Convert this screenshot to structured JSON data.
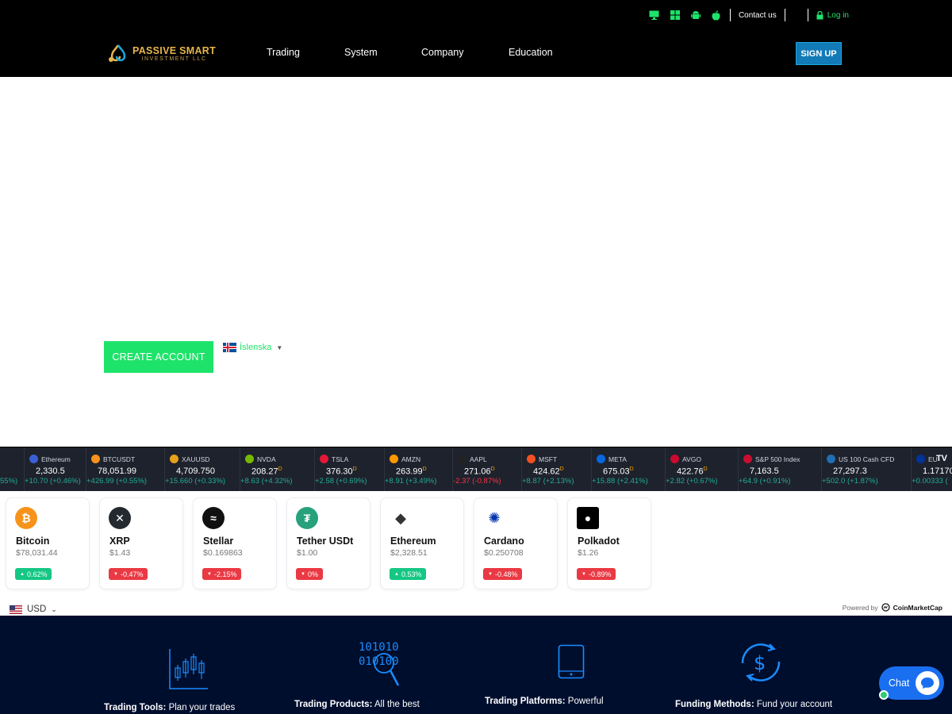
{
  "topbar": {
    "contact": "Contact us",
    "login": "Log in"
  },
  "brand": {
    "name": "PASSIVE SMART",
    "sub": "INVESTMENT LLC"
  },
  "nav": [
    "Trading",
    "System",
    "Company",
    "Education"
  ],
  "signup": "SIGN UP",
  "hero": {
    "create_account": "CREATE ACCOUNT",
    "language": "Íslenska"
  },
  "ticker": [
    {
      "name": "Ethereum",
      "price": "2,330.5",
      "change": "+10.70 (+0.46%)",
      "dir": "up",
      "color": "#3a5fd8",
      "partial_left": "55%)"
    },
    {
      "name": "BTCUSDT",
      "price": "78,051.99",
      "change": "+426.99 (+0.55%)",
      "dir": "up",
      "color": "#f7931a"
    },
    {
      "name": "XAUUSD",
      "price": "4,709.750",
      "change": "+15.660 (+0.33%)",
      "dir": "up",
      "color": "#e8a219"
    },
    {
      "name": "NVDA",
      "price": "208.27",
      "change": "+8.63 (+4.32%)",
      "dir": "up",
      "color": "#76b900"
    },
    {
      "name": "TSLA",
      "price": "376.30",
      "change": "+2.58 (+0.69%)",
      "dir": "up",
      "color": "#e31937"
    },
    {
      "name": "AMZN",
      "price": "263.99",
      "change": "+8.91 (+3.49%)",
      "dir": "up",
      "color": "#ff9900"
    },
    {
      "name": "AAPL",
      "price": "271.06",
      "change": "-2.37 (-0.87%)",
      "dir": "down",
      "color": "#222"
    },
    {
      "name": "MSFT",
      "price": "424.62",
      "change": "+8.87 (+2.13%)",
      "dir": "up",
      "color": "#f25022"
    },
    {
      "name": "META",
      "price": "675.03",
      "change": "+15.88 (+2.41%)",
      "dir": "up",
      "color": "#0668e1"
    },
    {
      "name": "AVGO",
      "price": "422.76",
      "change": "+2.82 (+0.67%)",
      "dir": "up",
      "color": "#cc092f"
    },
    {
      "name": "S&P 500 Index",
      "price": "7,163.5",
      "change": "+64.9 (+0.91%)",
      "dir": "up",
      "color": "#c8102e"
    },
    {
      "name": "US 100 Cash CFD",
      "price": "27,297.3",
      "change": "+502.0 (+1.87%)",
      "dir": "up",
      "color": "#1f6fb2"
    },
    {
      "name": "EU",
      "price": "1.17170",
      "change": "+0.00333 (",
      "dir": "up",
      "color": "#003399"
    }
  ],
  "coins": [
    {
      "name": "Bitcoin",
      "price": "$78,031.44",
      "change": "0.62%",
      "dir": "up",
      "color": "#f7931a",
      "symbol": "₿"
    },
    {
      "name": "XRP",
      "price": "$1.43",
      "change": "-0.47%",
      "dir": "down",
      "color": "#23292f",
      "symbol": "✕"
    },
    {
      "name": "Stellar",
      "price": "$0.169863",
      "change": "-2.15%",
      "dir": "down",
      "color": "#111111",
      "symbol": "≈"
    },
    {
      "name": "Tether USDt",
      "price": "$1.00",
      "change": "0%",
      "dir": "down",
      "color": "#26a17b",
      "symbol": "₮"
    },
    {
      "name": "Ethereum",
      "price": "$2,328.51",
      "change": "0.53%",
      "dir": "up",
      "color": "#ffffff",
      "symbol": "◆"
    },
    {
      "name": "Cardano",
      "price": "$0.250708",
      "change": "-0.48%",
      "dir": "down",
      "color": "#ffffff",
      "symbol": "✺"
    },
    {
      "name": "Polkadot",
      "price": "$1.26",
      "change": "-0.89%",
      "dir": "down",
      "color": "#000000",
      "symbol": "●"
    }
  ],
  "currency": "USD",
  "powered": {
    "label": "Powered by",
    "brand": "CoinMarketCap"
  },
  "features": [
    {
      "title": "Trading Tools:",
      "text": " Plan your trades",
      "icon": "candlestick-chart-icon"
    },
    {
      "title": "Trading Products:",
      "text": " All the best",
      "icon": "binary-search-icon"
    },
    {
      "title": "Trading Platforms:",
      "text": " Powerful",
      "icon": "tablet-icon"
    },
    {
      "title": "Funding Methods:",
      "text": " Fund your account",
      "icon": "dollar-exchange-icon"
    }
  ],
  "chat": "Chat"
}
